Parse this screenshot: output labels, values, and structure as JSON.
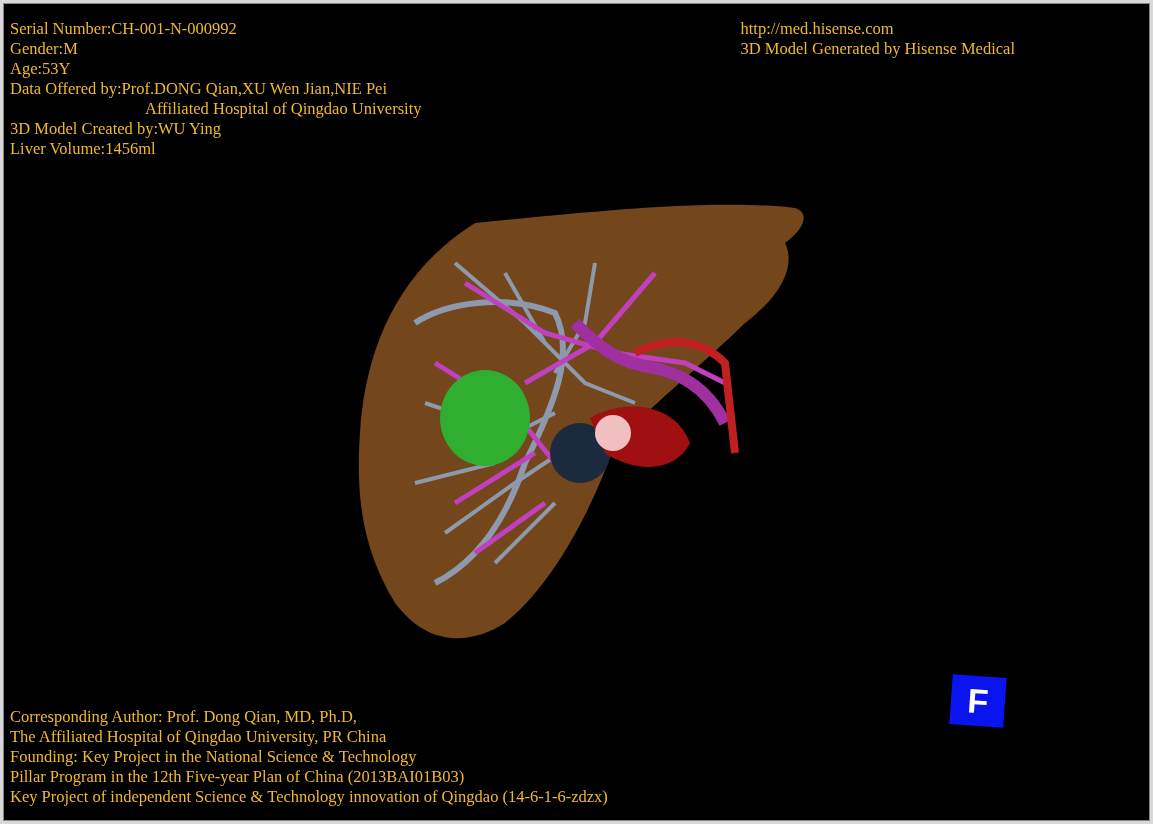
{
  "info_left": [
    {
      "text": "Serial Number:CH-001-N-000992"
    },
    {
      "text": "Gender:M"
    },
    {
      "text": "Age:53Y"
    },
    {
      "text": "Data Offered by:Prof.DONG Qian,XU Wen Jian,NIE Pei",
      "continuation": "Affiliated Hospital of Qingdao University"
    },
    {
      "text": "3D Model Created by:WU Ying"
    },
    {
      "text": "Liver Volume:1456ml"
    }
  ],
  "info_right": [
    "http://med.hisense.com",
    "3D Model Generated by Hisense Medical"
  ],
  "credits": [
    "Corresponding Author: Prof. Dong Qian, MD, Ph.D,",
    "The Affiliated Hospital of Qingdao University, PR China",
    "Founding: Key Project in the National Science & Technology",
    "Pillar Program in the 12th Five-year Plan of China (2013BAI01B03)",
    "Key Project of independent Science & Technology innovation of Qingdao (14-6-1-6-zdzx)"
  ],
  "orientation_cube": {
    "label": "F"
  }
}
